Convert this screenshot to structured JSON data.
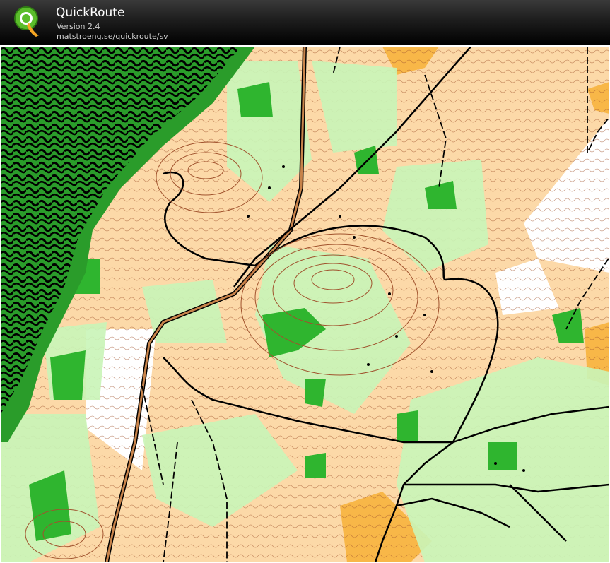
{
  "app": {
    "title": "QuickRoute",
    "version": "Version 2.4",
    "url": "matstroeng.se/quickroute/sv"
  },
  "logo": {
    "letter": "Q"
  },
  "colors": {
    "open_land": "#fcd9a8",
    "rough_open": "#f8b748",
    "forest_light_green": "#c9f5b8",
    "forest_green": "#2fb52f",
    "dark_green": "#1c8f1c",
    "contour": "#a0522d",
    "track": "#000000",
    "white_forest": "#ffffff"
  }
}
